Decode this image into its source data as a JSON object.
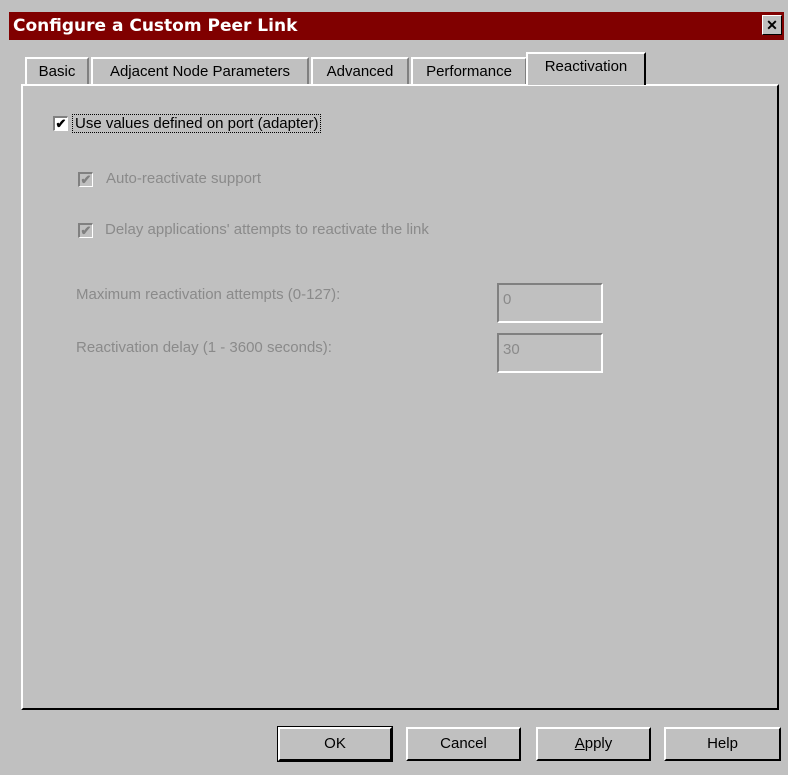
{
  "window": {
    "title": "Configure a Custom Peer Link",
    "close_glyph": "✕"
  },
  "tabs": [
    {
      "label": "Basic"
    },
    {
      "label": "Adjacent Node Parameters"
    },
    {
      "label": "Advanced"
    },
    {
      "label": "Performance"
    },
    {
      "label": "Reactivation",
      "active": true
    }
  ],
  "reactivation": {
    "use_port_values": {
      "label": "Use values defined on port (adapter)",
      "checked": true
    },
    "auto_reactivate": {
      "label": "Auto-reactivate support",
      "checked": true,
      "disabled": true
    },
    "delay_apps": {
      "label": "Delay applications' attempts to reactivate the link",
      "checked": true,
      "disabled": true
    },
    "max_attempts": {
      "label": "Maximum reactivation attempts (0-127):",
      "value": "0"
    },
    "delay": {
      "label": "Reactivation delay (1 - 3600 seconds):",
      "value": "30"
    }
  },
  "buttons": {
    "ok": "OK",
    "cancel": "Cancel",
    "apply_prefix": "A",
    "apply_rest": "pply",
    "help": "Help"
  },
  "icons": {
    "check": "✔"
  }
}
